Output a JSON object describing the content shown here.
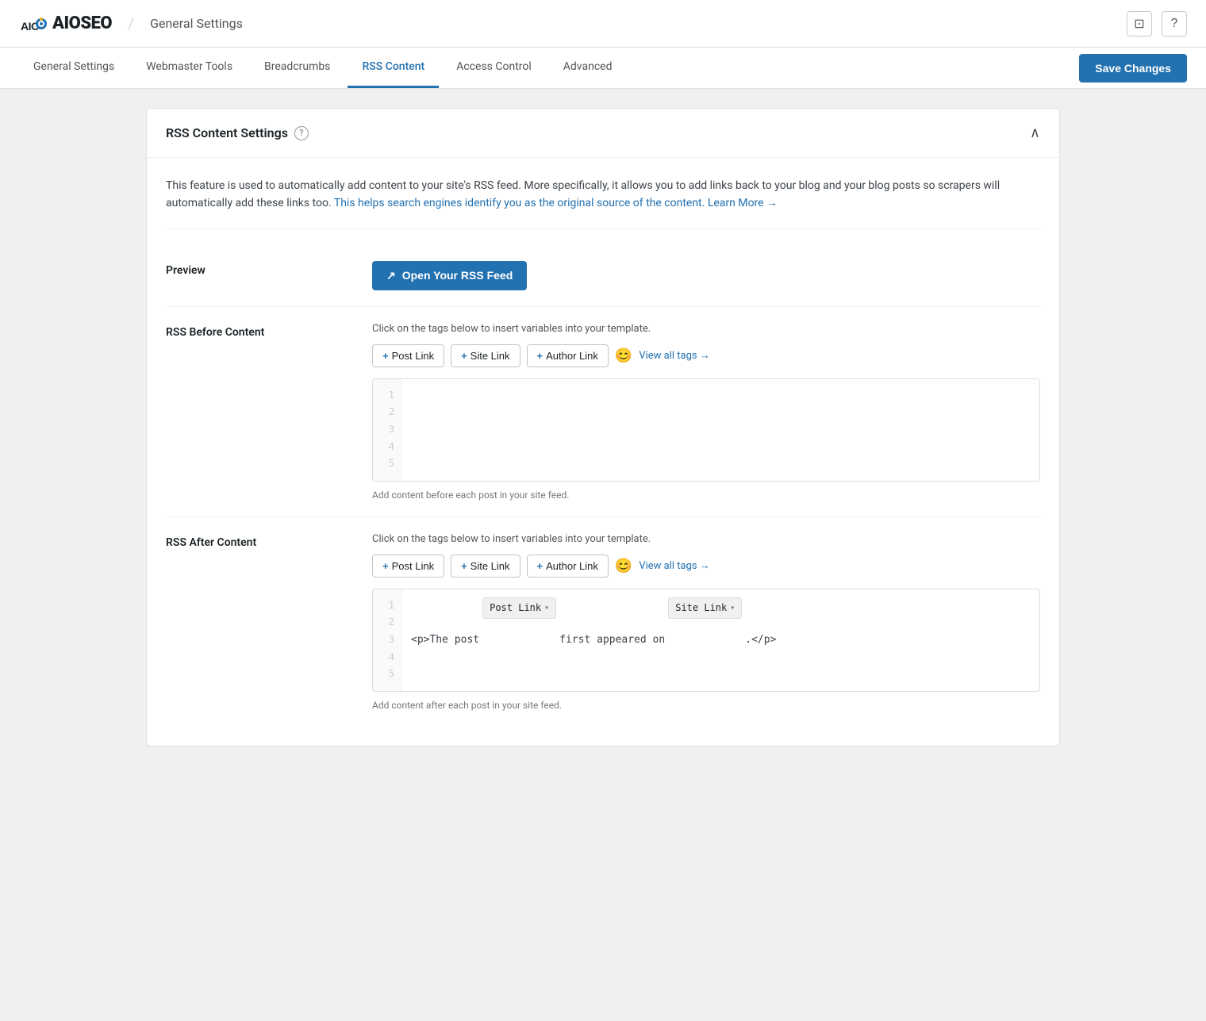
{
  "topbar": {
    "logo_text": "AIOSEO",
    "divider": "/",
    "page_title": "General Settings",
    "icon_monitor": "⊡",
    "icon_help": "?"
  },
  "nav": {
    "tabs": [
      {
        "id": "general-settings",
        "label": "General Settings",
        "active": false
      },
      {
        "id": "webmaster-tools",
        "label": "Webmaster Tools",
        "active": false
      },
      {
        "id": "breadcrumbs",
        "label": "Breadcrumbs",
        "active": false
      },
      {
        "id": "rss-content",
        "label": "RSS Content",
        "active": true
      },
      {
        "id": "access-control",
        "label": "Access Control",
        "active": false
      },
      {
        "id": "advanced",
        "label": "Advanced",
        "active": false
      }
    ],
    "save_button": "Save Changes"
  },
  "rss_settings": {
    "card_title": "RSS Content Settings",
    "description_part1": "This feature is used to automatically add content to your site's RSS feed. More specifically, it allows you to add links back to your blog and your blog posts so scrapers will automatically add these links too.",
    "description_part2": "This helps search engines identify you as the original source of the content.",
    "learn_more": "Learn More →",
    "preview": {
      "label": "Preview",
      "button": "Open Your RSS Feed"
    },
    "rss_before": {
      "label": "RSS Before Content",
      "instruction": "Click on the tags below to insert variables into your template.",
      "tags": [
        {
          "label": "Post Link",
          "id": "post-link"
        },
        {
          "label": "Site Link",
          "id": "site-link"
        },
        {
          "label": "Author Link",
          "id": "author-link"
        }
      ],
      "view_all": "View all tags →",
      "line_numbers": [
        "1",
        "2",
        "3",
        "4",
        "5"
      ],
      "helper_text": "Add content before each post in your site feed.",
      "content": ""
    },
    "rss_after": {
      "label": "RSS After Content",
      "instruction": "Click on the tags below to insert variables into your template.",
      "tags": [
        {
          "label": "Post Link",
          "id": "post-link-after"
        },
        {
          "label": "Site Link",
          "id": "site-link-after"
        },
        {
          "label": "Author Link",
          "id": "author-link-after"
        }
      ],
      "view_all": "View all tags →",
      "line_numbers": [
        "1",
        "2",
        "3",
        "4",
        "5"
      ],
      "helper_text": "Add content after each post in your site feed.",
      "content_prefix": "<p>The post",
      "content_middle": "first appeared on",
      "content_suffix": ".</p>",
      "post_link_tag": "Post Link",
      "site_link_tag": "Site Link"
    }
  }
}
